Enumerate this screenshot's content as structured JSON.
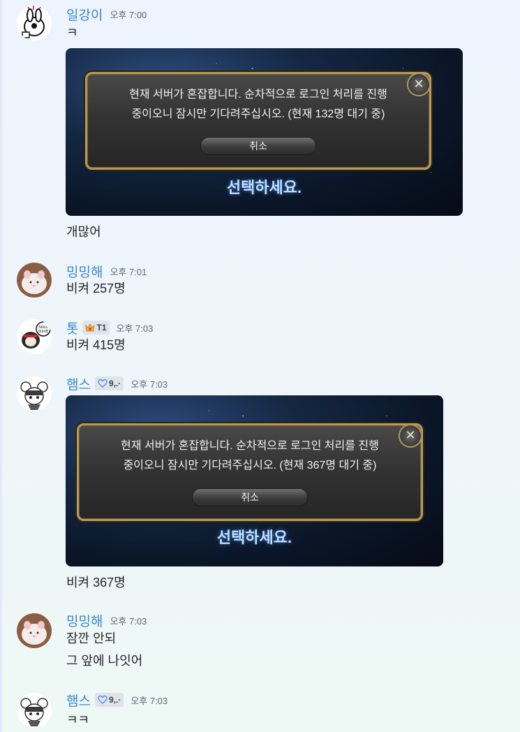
{
  "messages": [
    {
      "author": "일강이",
      "time": "오후 7:00",
      "lines": [
        "ㅋ"
      ],
      "attachment": {
        "dialog_text": "현재 서버가 혼잡합니다. 순차적으로 로그인 처리를 진행\n중이오니 잠시만 기다려주십시오. (현재 132명 대기 중)",
        "button_label": "취소",
        "background_text": "선택하세요."
      },
      "after_lines": [
        "개많어"
      ]
    },
    {
      "author": "밍밍해",
      "time": "오후 7:01",
      "lines": [
        "비켜 257명"
      ]
    },
    {
      "author": "톳",
      "badge": "T1",
      "time": "오후 7:03",
      "lines": [
        "비켜 415명"
      ]
    },
    {
      "author": "햄스",
      "badge": "9,.·",
      "time": "오후 7:03",
      "attachment": {
        "dialog_text": "현재 서버가 혼잡합니다. 순차적으로 로그인 처리를 진행\n중이오니 잠시만 기다려주십시오. (현재 367명 대기 중)",
        "button_label": "취소",
        "background_text": "선택하세요."
      },
      "after_lines": [
        "비켜 367명"
      ]
    },
    {
      "author": "밍밍해",
      "time": "오후 7:03",
      "lines": [
        "잠깐 안되",
        "그 앞에 나잇어"
      ]
    },
    {
      "author": "햄스",
      "badge": "9,.·",
      "time": "오후 7:03",
      "lines": [
        "ㅋㅋ"
      ]
    }
  ],
  "colors": {
    "author_name": "#3a86cf",
    "timestamp": "#5c6470",
    "dialog_border": "#b79a5a"
  },
  "icons": {
    "avatar_1": "rabbit-doodle-avatar",
    "avatar_2": "white-hamster-avatar",
    "avatar_3": "skill-issue-avatar",
    "avatar_4": "mouse-character-avatar",
    "badge_1": "crown-icon",
    "badge_2": "heart-icon",
    "dialog_close": "close-x-icon"
  }
}
